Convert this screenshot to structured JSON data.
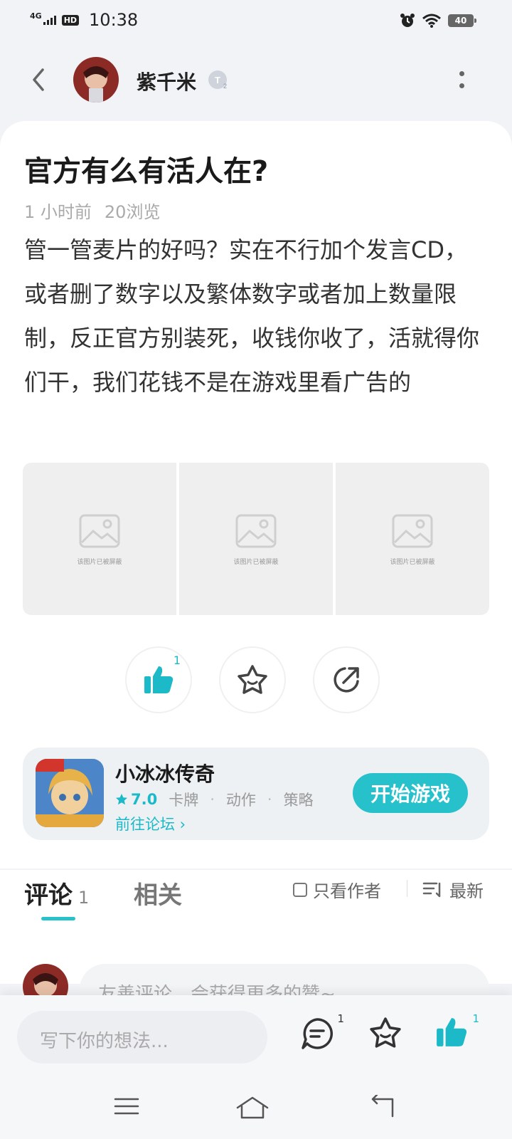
{
  "status_bar": {
    "network": "4G",
    "hd": "HD",
    "time": "10:38",
    "battery": "40"
  },
  "header": {
    "author": "紫千米",
    "level": "T2"
  },
  "post": {
    "title": "官方有么有活人在?",
    "time": "1 小时前",
    "views": "20浏览",
    "body": "管一管麦片的好吗？实在不行加个发言CD，或者删了数字以及繁体数字或者加上数量限制，反正官方别装死，收钱你收了，活就得你们干，我们花钱不是在游戏里看广告的",
    "images": [
      {
        "caption": "该图片已被屏蔽"
      },
      {
        "caption": "该图片已被屏蔽"
      },
      {
        "caption": "该图片已被屏蔽"
      }
    ],
    "like_count": "1"
  },
  "game": {
    "name": "小冰冰传奇",
    "score": "7.0",
    "tags": [
      "卡牌",
      "动作",
      "策略"
    ],
    "forum_link": "前往论坛 ›",
    "play_label": "开始游戏",
    "accent": "#27c1cc"
  },
  "comments_section": {
    "tab_comments": "评论",
    "comments_count": "1",
    "tab_related": "相关",
    "filter_author": "只看作者",
    "sort_label": "最新",
    "prompt": "友善评论，会获得更多的赞~"
  },
  "bottom_bar": {
    "composer_placeholder": "写下你的想法...",
    "comment_count": "1",
    "like_count": "1"
  }
}
